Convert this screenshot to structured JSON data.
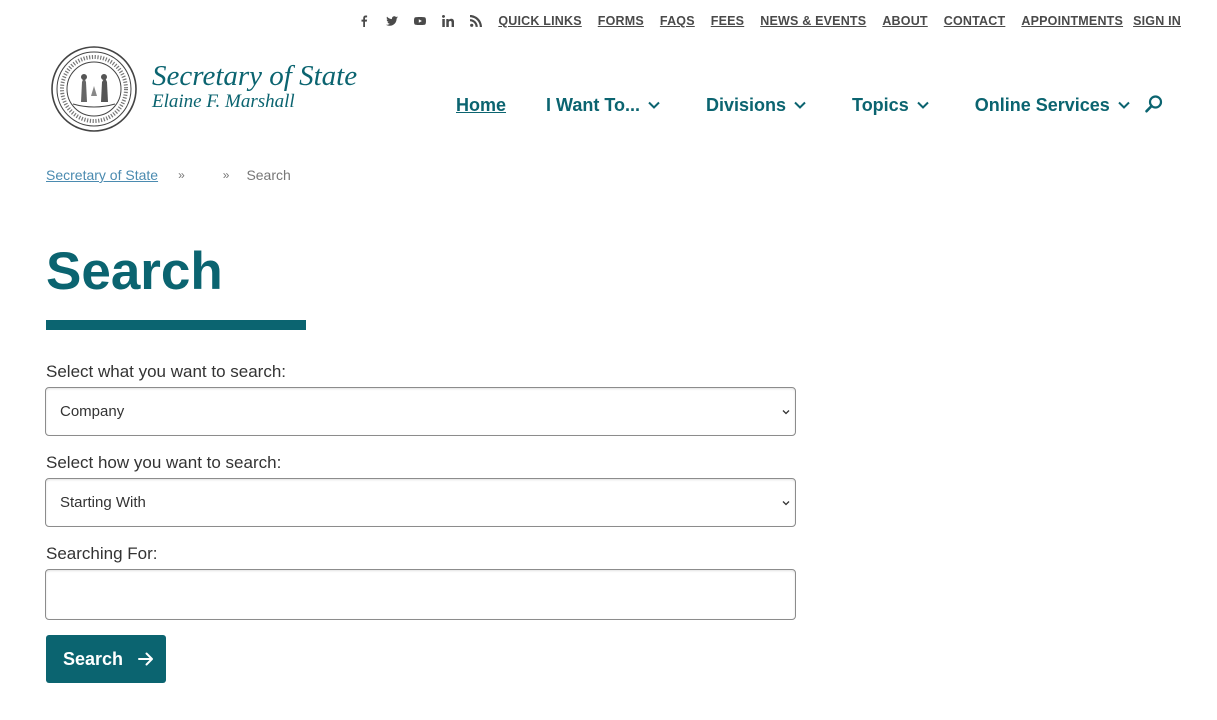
{
  "utility_bar": {
    "social_icons": [
      "facebook-icon",
      "twitter-icon",
      "youtube-icon",
      "linkedin-icon",
      "rss-icon"
    ],
    "links": [
      {
        "label": "QUICK LINKS"
      },
      {
        "label": "FORMS"
      },
      {
        "label": "FAQS"
      },
      {
        "label": "FEES"
      },
      {
        "label": "NEWS & EVENTS"
      },
      {
        "label": "ABOUT"
      },
      {
        "label": "CONTACT"
      },
      {
        "label": "APPOINTMENTS"
      }
    ],
    "sign_in": "SIGN IN"
  },
  "header": {
    "title": "Secretary of State",
    "subtitle": "Elaine F. Marshall",
    "seal_icon": "state-seal-icon"
  },
  "nav": {
    "items": [
      {
        "label": "Home",
        "active": true
      },
      {
        "label": "I Want To...",
        "dropdown": true
      },
      {
        "label": "Divisions",
        "dropdown": true
      },
      {
        "label": "Topics",
        "dropdown": true
      },
      {
        "label": "Online Services",
        "dropdown": true
      }
    ],
    "search_icon": "search-icon"
  },
  "breadcrumb": {
    "root": "Secretary of State",
    "separator": "»",
    "current": "Search"
  },
  "page": {
    "title": "Search"
  },
  "form": {
    "what_label": "Select what you want to search:",
    "what_value": "Company",
    "how_label": "Select how you want to search:",
    "how_value": "Starting With",
    "for_label": "Searching For:",
    "for_value": "",
    "submit_label": "Search"
  },
  "colors": {
    "brand_teal": "#0b6470",
    "link_blue": "#4b8bb0",
    "text_dark": "#333333"
  }
}
